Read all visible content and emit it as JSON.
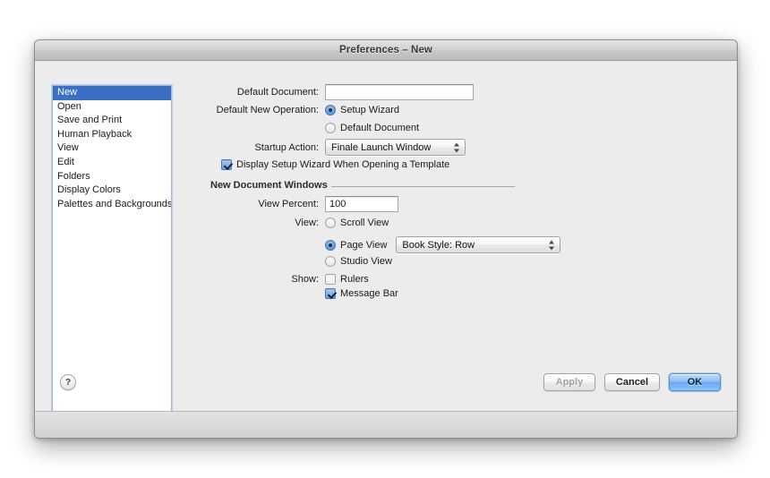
{
  "window": {
    "title": "Preferences – New"
  },
  "sidebar": {
    "items": [
      {
        "label": "New",
        "selected": true
      },
      {
        "label": "Open",
        "selected": false
      },
      {
        "label": "Save and Print",
        "selected": false
      },
      {
        "label": "Human Playback",
        "selected": false
      },
      {
        "label": "View",
        "selected": false
      },
      {
        "label": "Edit",
        "selected": false
      },
      {
        "label": "Folders",
        "selected": false
      },
      {
        "label": "Display Colors",
        "selected": false
      },
      {
        "label": "Palettes and Backgrounds",
        "selected": false
      }
    ]
  },
  "pane": {
    "default_document": {
      "label": "Default Document:",
      "value": "",
      "placeholder": ""
    },
    "default_new_operation": {
      "label": "Default New Operation:",
      "options": [
        {
          "label": "Setup Wizard",
          "selected": true
        },
        {
          "label": "Default Document",
          "selected": false
        }
      ]
    },
    "startup_action": {
      "label": "Startup Action:",
      "value": "Finale Launch Window"
    },
    "display_setup_wizard": {
      "label": "Display Setup Wizard When Opening a Template",
      "checked": true
    },
    "group_new_document_windows": {
      "title": "New Document Windows",
      "view_percent": {
        "label": "View Percent:",
        "value": "100"
      },
      "view": {
        "label": "View:",
        "options": [
          {
            "label": "Scroll View",
            "selected": false
          },
          {
            "label": "Page View",
            "selected": true
          },
          {
            "label": "Studio View",
            "selected": false
          }
        ],
        "page_view_style": "Book Style: Row"
      },
      "show": {
        "label": "Show:",
        "options": [
          {
            "label": "Rulers",
            "checked": false
          },
          {
            "label": "Message Bar",
            "checked": true
          }
        ]
      }
    }
  },
  "footer": {
    "help_label": "?",
    "apply_label": "Apply",
    "cancel_label": "Cancel",
    "ok_label": "OK"
  },
  "colors": {
    "selection_blue": "#3a6fc4",
    "default_button_blue": "#6aaaf0",
    "window_background": "#ececec"
  }
}
